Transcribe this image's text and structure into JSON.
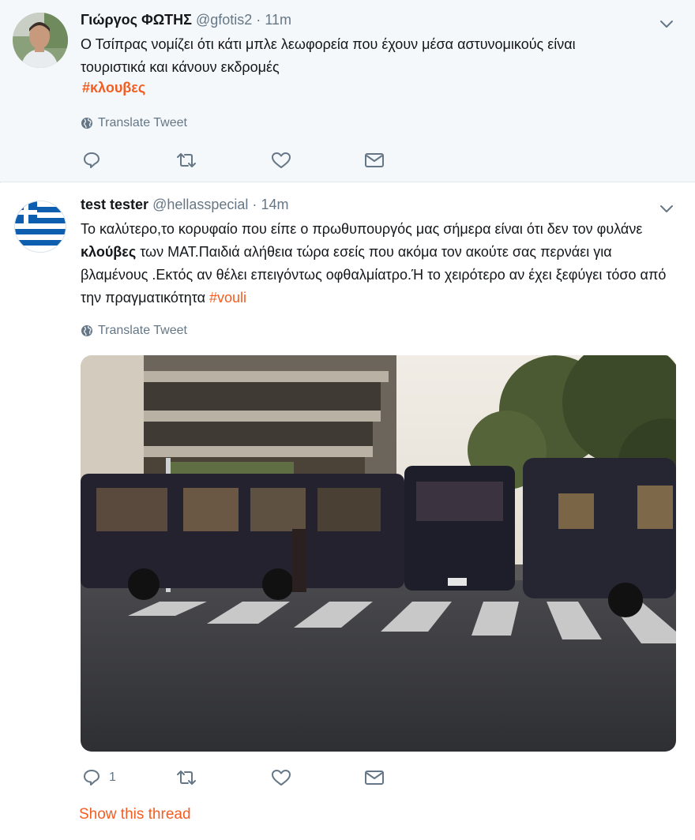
{
  "colors": {
    "accent": "#f45d22",
    "secondary_text": "#657786",
    "primary_text": "#14171a"
  },
  "tweets": [
    {
      "avatar_icon": "man-photo-avatar",
      "name": "Γιώργος ΦΩΤΗΣ",
      "handle": "@gfotis2",
      "separator": "·",
      "time": "11m",
      "text_line1": "Ο Τσίπρας νομίζει ότι κάτι μπλε λεωφορεία που έχουν μέσα αστυνομικούς είναι",
      "text_line2": "τουριστικά και κάνουν εκδρομές",
      "hashtag": "#κλουβες",
      "translate_label": "Translate Tweet"
    },
    {
      "avatar_icon": "greek-flag-avatar",
      "name": "test tester",
      "handle": "@hellasspecial",
      "separator": "·",
      "time": "14m",
      "text_part1": "Το καλύτερο,το κορυφαίο που είπε ο πρωθυπουργός μας σήμερα είναι ότι  δεν τον φυλάνε ",
      "text_bold": "κλούβες",
      "text_part2": " των ΜΑΤ.Παιδιά αλήθεια τώρα εσείς που ακόμα τον ακούτε σας περνάει για βλαμένους .Εκτός αν θέλει επειγόντως οφθαλμίατρο.Ή το χειρότερο αν έχει ξεφύγει τόσο από την πραγματικότητα ",
      "hashtag": "#vouli",
      "translate_label": "Translate Tweet",
      "reply_count": "1",
      "media_icon": "police-buses-photo",
      "show_thread_label": "Show this thread"
    }
  ]
}
